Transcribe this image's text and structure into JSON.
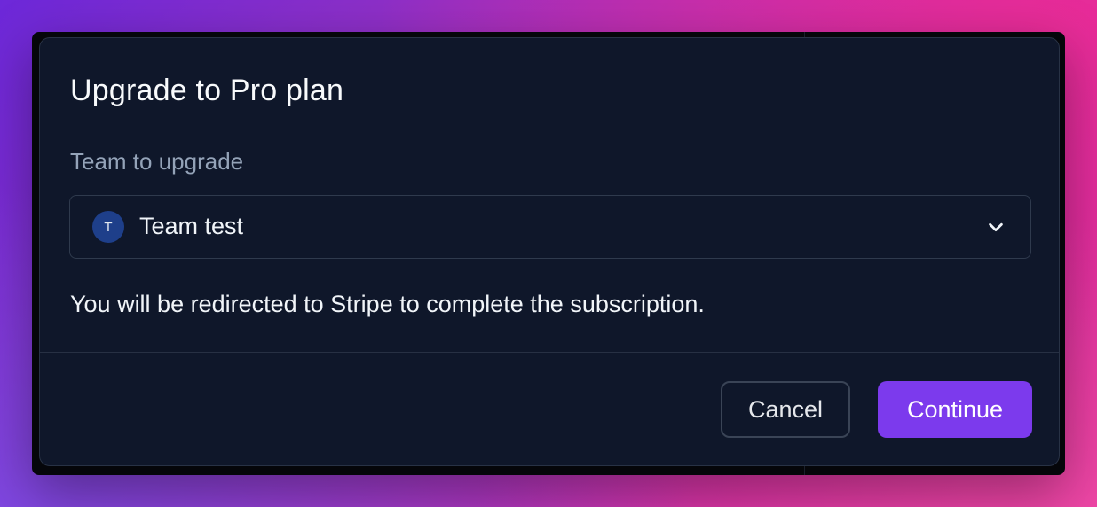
{
  "dialog": {
    "title": "Upgrade to Pro plan",
    "field_label": "Team to upgrade",
    "select": {
      "avatar_initial": "T",
      "value": "Team test",
      "icon": "chevron-down-icon"
    },
    "note": "You will be redirected to Stripe to complete the subscription.",
    "buttons": {
      "cancel_label": "Cancel",
      "continue_label": "Continue"
    }
  },
  "colors": {
    "dialog_background": "#0f172a",
    "primary_button": "#7c3aed",
    "avatar": "#1e3f8a"
  }
}
